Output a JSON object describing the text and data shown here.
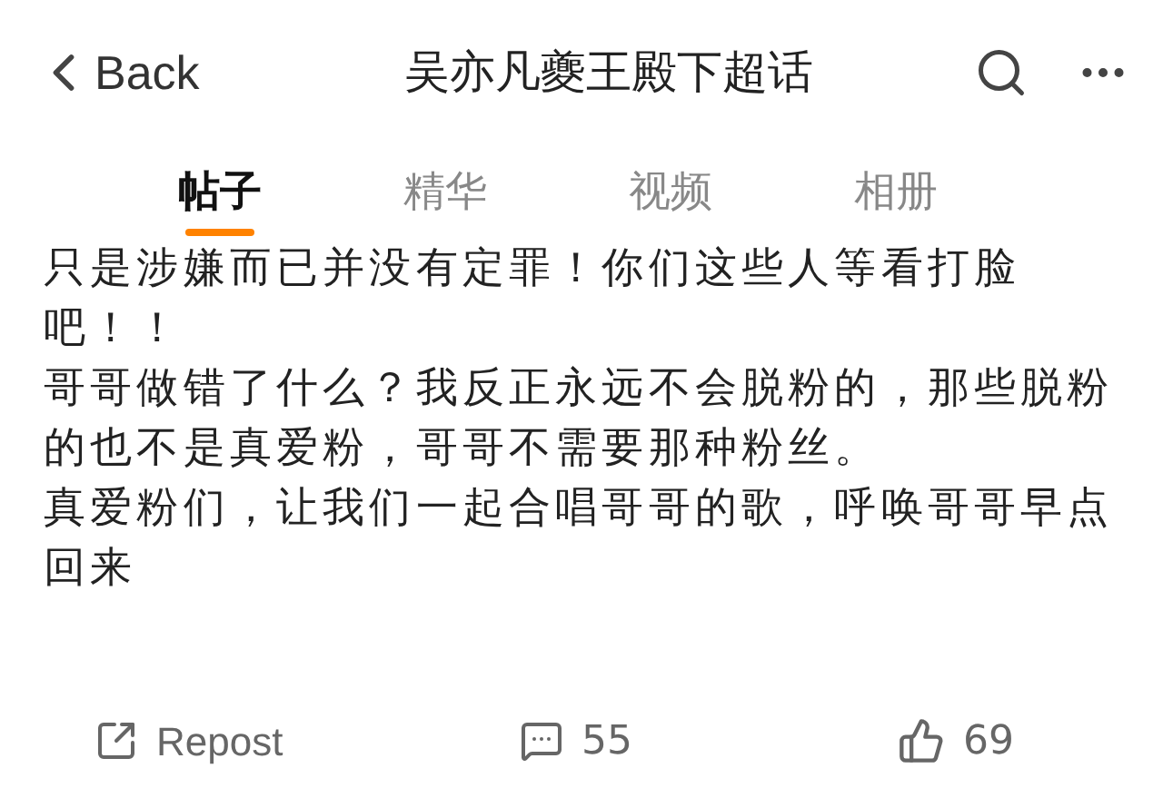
{
  "header": {
    "back": "Back",
    "title": "吴亦凡夔王殿下超话"
  },
  "tabs": [
    {
      "label": "帖子",
      "selected": true
    },
    {
      "label": "精华",
      "selected": false
    },
    {
      "label": "视频",
      "selected": false
    },
    {
      "label": "相册",
      "selected": false
    }
  ],
  "post": {
    "paragraphs": [
      "只是涉嫌而已并没有定罪！你们这些人等看打脸吧！！",
      "哥哥做错了什么？我反正永远不会脱粉的，那些脱粉的也不是真爱粉，哥哥不需要那种粉丝。",
      "真爱粉们，让我们一起合唱哥哥的歌，呼唤哥哥早点回来"
    ]
  },
  "actions": {
    "repost": "Repost",
    "comments": "55",
    "likes": "69"
  }
}
